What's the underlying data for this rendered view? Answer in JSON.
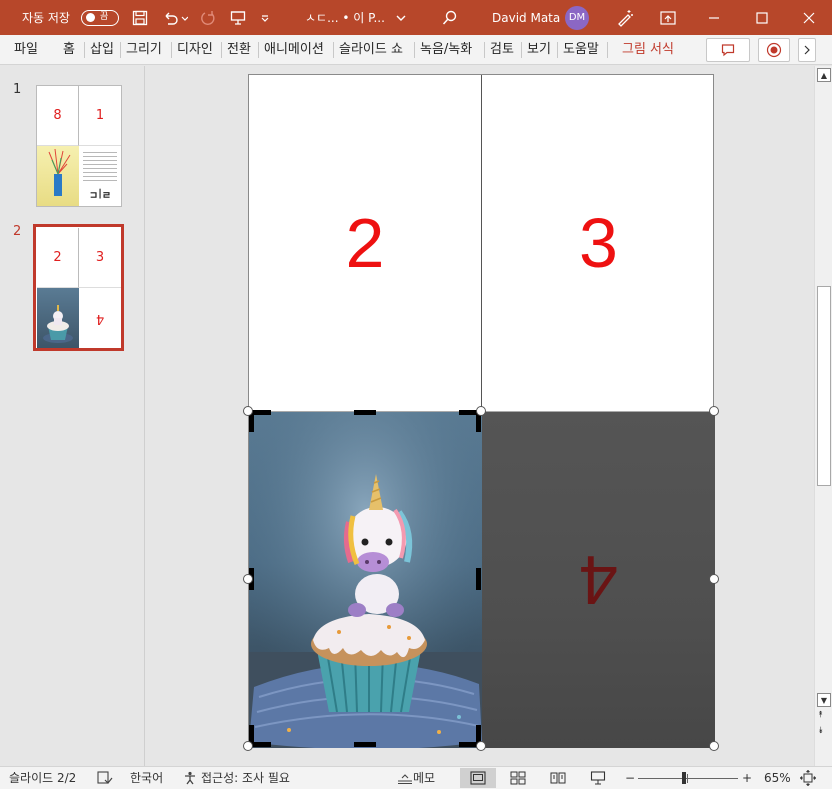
{
  "titlebar": {
    "autosave_label": "자동 저장",
    "autosave_state": "끔",
    "doc_title": "ㅅㄷ...  •  이 P...",
    "user_name": "David Mata",
    "user_initials": "DM",
    "bg_color": "#b7472a"
  },
  "ribbon": {
    "tabs": [
      "파일",
      "홈",
      "삽입",
      "그리기",
      "디자인",
      "전환",
      "애니메이션",
      "슬라이드 쇼",
      "녹음/녹화",
      "검토",
      "보기",
      "도움말"
    ],
    "contextual_tab": "그림 서식",
    "accent_color": "#c0392b"
  },
  "thumbnails": {
    "items": [
      {
        "number": "1",
        "q1": "8",
        "q2": "1",
        "q4": "ㄹ|ㄷ"
      },
      {
        "number": "2",
        "q1": "2",
        "q2": "3",
        "q4": "4"
      }
    ]
  },
  "slide": {
    "cell_top_left": "2",
    "cell_top_right": "3",
    "cell_bottom_right": "4",
    "number_color": "#ee1111"
  },
  "status": {
    "slide_indicator": "슬라이드 2/2",
    "language": "한국어",
    "accessibility": "접근성: 조사 필요",
    "notes_label": "메모",
    "zoom_minus": "−",
    "zoom_plus": "+",
    "zoom_level": "65%",
    "zoom_fraction": 0.46
  }
}
